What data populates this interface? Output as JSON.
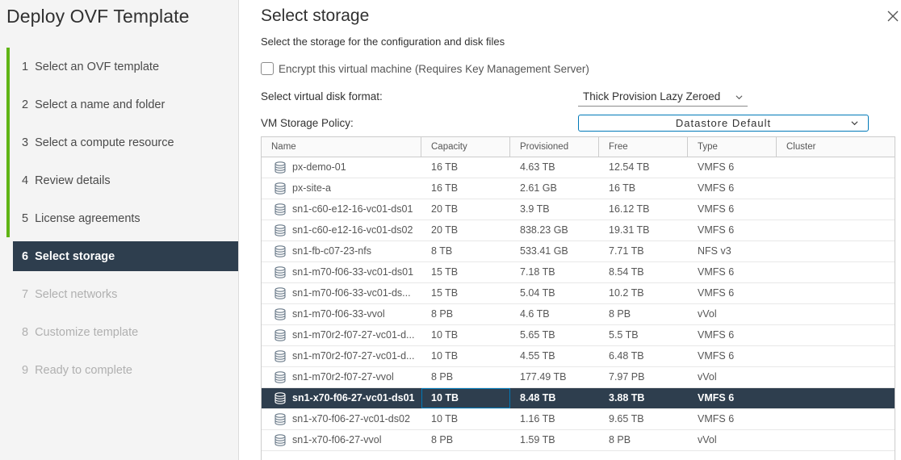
{
  "wizard": {
    "title": "Deploy OVF Template",
    "steps": [
      {
        "num": "1",
        "label": "Select an OVF template",
        "state": "done"
      },
      {
        "num": "2",
        "label": "Select a name and folder",
        "state": "done"
      },
      {
        "num": "3",
        "label": "Select a compute resource",
        "state": "done"
      },
      {
        "num": "4",
        "label": "Review details",
        "state": "done"
      },
      {
        "num": "5",
        "label": "License agreements",
        "state": "done"
      },
      {
        "num": "6",
        "label": "Select storage",
        "state": "current"
      },
      {
        "num": "7",
        "label": "Select networks",
        "state": "future"
      },
      {
        "num": "8",
        "label": "Customize template",
        "state": "future"
      },
      {
        "num": "9",
        "label": "Ready to complete",
        "state": "future"
      }
    ]
  },
  "page": {
    "title": "Select storage",
    "subtitle": "Select the storage for the configuration and disk files",
    "close_icon": "close-icon"
  },
  "encrypt": {
    "label": "Encrypt this virtual machine (Requires Key Management Server)",
    "checked": false
  },
  "disk_format": {
    "label": "Select virtual disk format:",
    "value": "Thick Provision Lazy Zeroed"
  },
  "storage_policy": {
    "label": "VM Storage Policy:",
    "value": "Datastore Default"
  },
  "table": {
    "columns": [
      "Name",
      "Capacity",
      "Provisioned",
      "Free",
      "Type",
      "Cluster"
    ],
    "rows": [
      {
        "name": "px-demo-01",
        "capacity": "16 TB",
        "provisioned": "4.63 TB",
        "free": "12.54 TB",
        "type": "VMFS 6",
        "cluster": ""
      },
      {
        "name": "px-site-a",
        "capacity": "16 TB",
        "provisioned": "2.61 GB",
        "free": "16 TB",
        "type": "VMFS 6",
        "cluster": ""
      },
      {
        "name": "sn1-c60-e12-16-vc01-ds01",
        "capacity": "20 TB",
        "provisioned": "3.9 TB",
        "free": "16.12 TB",
        "type": "VMFS 6",
        "cluster": ""
      },
      {
        "name": "sn1-c60-e12-16-vc01-ds02",
        "capacity": "20 TB",
        "provisioned": "838.23 GB",
        "free": "19.31 TB",
        "type": "VMFS 6",
        "cluster": ""
      },
      {
        "name": "sn1-fb-c07-23-nfs",
        "capacity": "8 TB",
        "provisioned": "533.41 GB",
        "free": "7.71 TB",
        "type": "NFS v3",
        "cluster": ""
      },
      {
        "name": "sn1-m70-f06-33-vc01-ds01",
        "capacity": "15 TB",
        "provisioned": "7.18 TB",
        "free": "8.54 TB",
        "type": "VMFS 6",
        "cluster": ""
      },
      {
        "name": "sn1-m70-f06-33-vc01-ds...",
        "capacity": "15 TB",
        "provisioned": "5.04 TB",
        "free": "10.2 TB",
        "type": "VMFS 6",
        "cluster": ""
      },
      {
        "name": "sn1-m70-f06-33-vvol",
        "capacity": "8 PB",
        "provisioned": "4.6 TB",
        "free": "8 PB",
        "type": "vVol",
        "cluster": ""
      },
      {
        "name": "sn1-m70r2-f07-27-vc01-d...",
        "capacity": "10 TB",
        "provisioned": "5.65 TB",
        "free": "5.5 TB",
        "type": "VMFS 6",
        "cluster": ""
      },
      {
        "name": "sn1-m70r2-f07-27-vc01-d...",
        "capacity": "10 TB",
        "provisioned": "4.55 TB",
        "free": "6.48 TB",
        "type": "VMFS 6",
        "cluster": ""
      },
      {
        "name": "sn1-m70r2-f07-27-vvol",
        "capacity": "8 PB",
        "provisioned": "177.49 TB",
        "free": "7.97 PB",
        "type": "vVol",
        "cluster": ""
      },
      {
        "name": "sn1-x70-f06-27-vc01-ds01",
        "capacity": "10 TB",
        "provisioned": "8.48 TB",
        "free": "3.88 TB",
        "type": "VMFS 6",
        "cluster": "",
        "selected": true
      },
      {
        "name": "sn1-x70-f06-27-vc01-ds02",
        "capacity": "10 TB",
        "provisioned": "1.16 TB",
        "free": "9.65 TB",
        "type": "VMFS 6",
        "cluster": ""
      },
      {
        "name": "sn1-x70-f06-27-vvol",
        "capacity": "8 PB",
        "provisioned": "1.59 TB",
        "free": "8 PB",
        "type": "vVol",
        "cluster": ""
      }
    ],
    "row_icon": "datastore-icon"
  },
  "colors": {
    "accent_blue": "#0079b8",
    "done_green": "#60b515",
    "selected_bg": "#2e3e4e"
  }
}
